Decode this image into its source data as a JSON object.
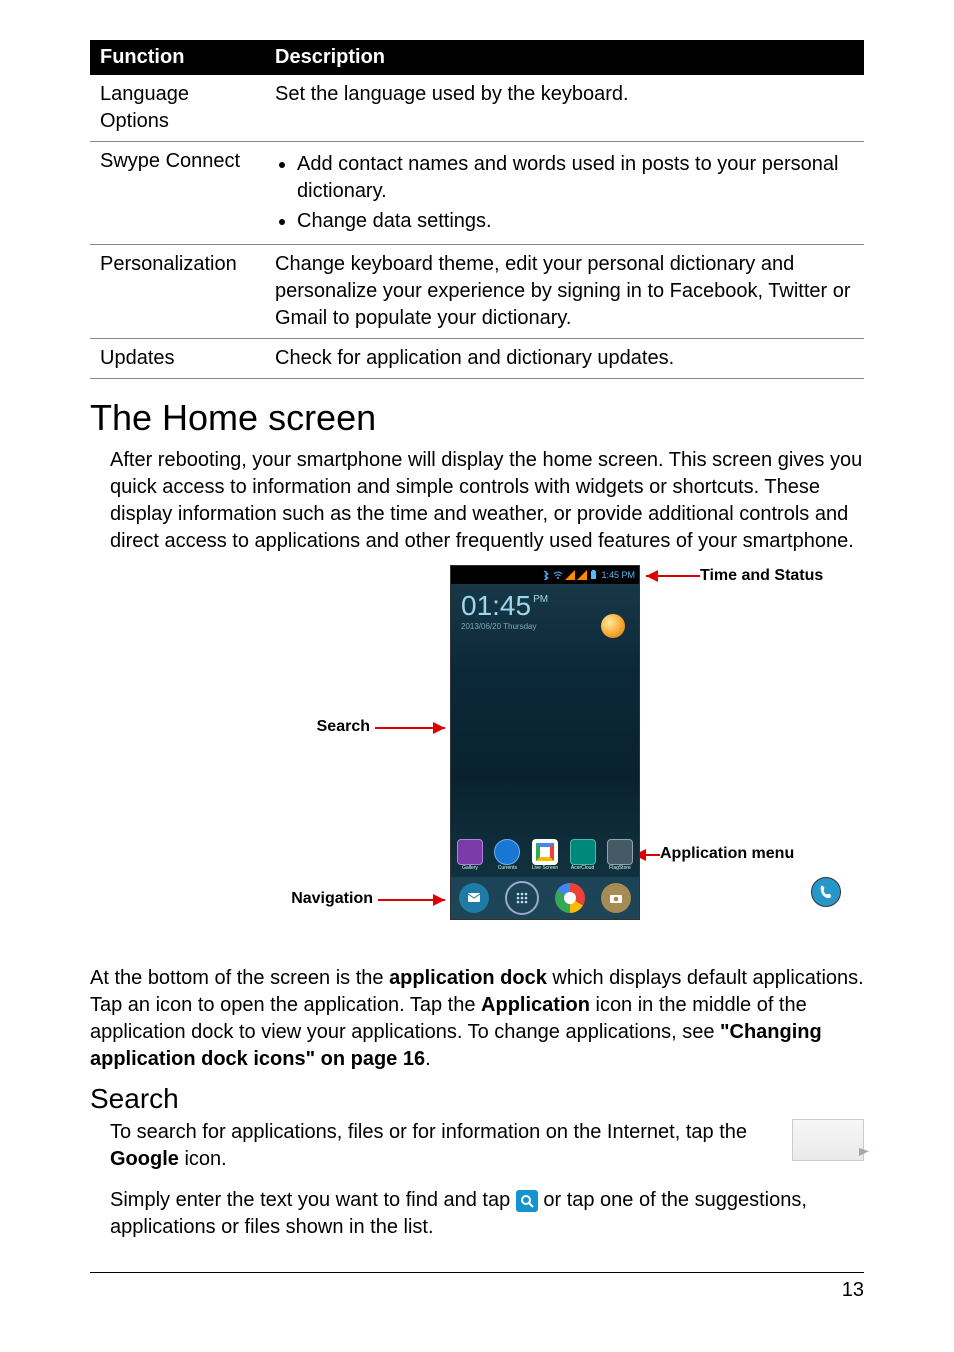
{
  "table": {
    "headers": {
      "col1": "Function",
      "col2": "Description"
    },
    "rows": {
      "lang": {
        "fn": "Language Options",
        "desc": "Set the language used by the keyboard."
      },
      "swype": {
        "fn": "Swype Connect",
        "b1": "Add contact names and words used in posts to your personal dictionary.",
        "b2": "Change data settings."
      },
      "pers": {
        "fn": "Personalization",
        "desc": "Change keyboard theme, edit your personal dictionary and personalize your experience by signing in to Facebook, Twitter or Gmail to populate your dictionary."
      },
      "upd": {
        "fn": "Updates",
        "desc": "Check for application and dictionary updates."
      }
    }
  },
  "h1": {
    "home": "The Home screen"
  },
  "p": {
    "home_intro": "After rebooting, your smartphone will display the home screen. This screen gives you quick access to information and simple controls with widgets or shortcuts. These display information such as the time and weather, or provide additional controls and direct access to applications and other frequently used features of your smartphone.",
    "dock1": "At the bottom of the screen is the ",
    "dock1b": "application dock",
    "dock2": " which displays default applications. Tap an icon to open the application. Tap the ",
    "dock2b": "Application",
    "dock3": " icon in the middle of the application dock to view your applications. To change applications, see ",
    "dock3b": "\"Changing application dock icons\" on page 16",
    "dock4": ".",
    "search1": "To search for applications, files or for information on the Internet, tap the ",
    "search1b": "Google",
    "search2": " icon.",
    "search3a": "Simply enter the text you want to find and tap ",
    "search3b": " or tap one of the suggestions, applications or files shown in the list."
  },
  "h2": {
    "search": "Search"
  },
  "callouts": {
    "time": "Time and Status",
    "search": "Search",
    "nav": "Navigation",
    "appmenu": "Application menu"
  },
  "phone": {
    "status_time": "1:45 PM",
    "clock_time": "01:45",
    "clock_pm": "PM",
    "clock_date": "2013/06/20 Thursday"
  },
  "page_number": "13"
}
